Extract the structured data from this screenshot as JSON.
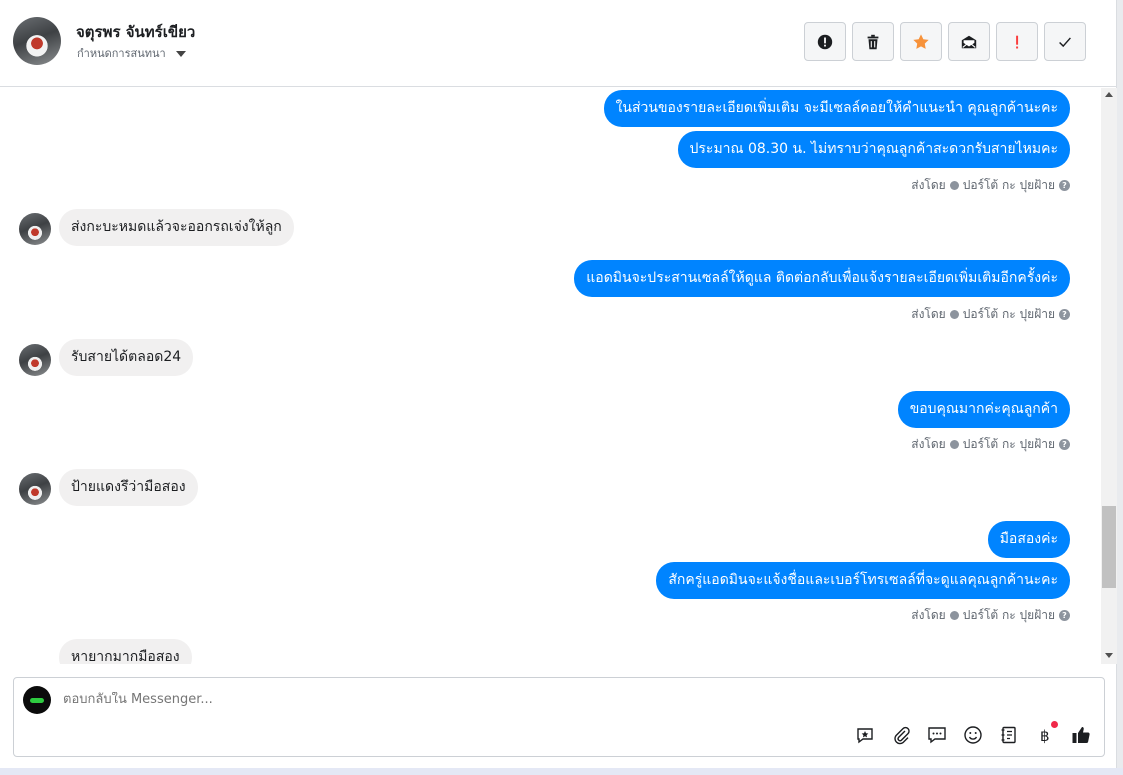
{
  "header": {
    "contact_name": "จตุรพร จันทร์เขียว",
    "assign_label": "กำหนดการสนทนา",
    "actions": [
      "report-icon",
      "trash-icon",
      "star-icon",
      "mark-unread-icon",
      "important-icon",
      "done-icon"
    ]
  },
  "colors": {
    "outgoing": "#0084ff",
    "incoming": "#f1f0f0",
    "star": "#f7923a",
    "alert": "#fa3e3e"
  },
  "messages": {
    "m1": "ในส่วนของรายละเอียดเพิ่มเติม จะมีเซลล์คอยให้คำแนะนำ คุณลูกค้านะคะ",
    "m2": "ประมาณ 08.30 น. ไม่ทราบว่าคุณลูกค้าสะดวกรับสายไหมคะ",
    "m3": "ส่งกะบะหมดแล้วจะออกรถเจ่งให้ลูก",
    "m4": "แอดมินจะประสานเซลล์ให้ดูแล ติดต่อกลับเพื่อแจ้งรายละเอียดเพิ่มเติมอีกครั้งค่ะ",
    "m5": "รับสายได้ตลอด24",
    "m6": "ขอบคุณมากค่ะคุณลูกค้า",
    "m7": "ป้ายแดงรึว่ามือสอง",
    "m8": "มือสองค่ะ",
    "m9": "สักครู่แอดมินจะแจ้งชื่อและเบอร์โทรเซลล์ที่จะดูแลคุณลูกค้านะคะ",
    "m10": "หายากมากมือสอง"
  },
  "sent_by": {
    "prefix": "ส่งโดย",
    "agent": "ปอร์โต้ กะ ปุยฝ้าย"
  },
  "composer": {
    "placeholder": "ตอบกลับใน Messenger...",
    "tools": [
      "saved-reply-icon",
      "attachment-icon",
      "chat-icon",
      "emoji-icon",
      "notes-icon",
      "payment-icon",
      "like-icon"
    ]
  }
}
